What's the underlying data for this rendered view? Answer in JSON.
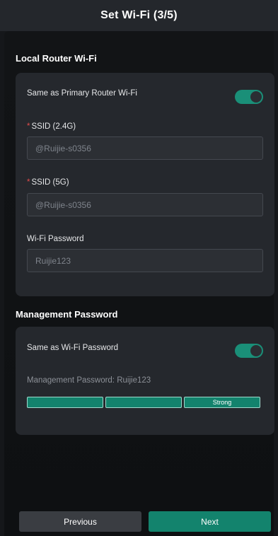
{
  "header": {
    "title": "Set Wi-Fi (3/5)"
  },
  "local_wifi": {
    "section_title": "Local Router Wi-Fi",
    "same_as_primary_label": "Same as Primary Router Wi-Fi",
    "same_as_primary_enabled": true,
    "required_mark": "*",
    "ssid_24_label": "SSID (2.4G)",
    "ssid_24_value": "@Ruijie-s0356",
    "ssid_5_label": "SSID (5G)",
    "ssid_5_value": "@Ruijie-s0356",
    "password_label": "Wi-Fi Password",
    "password_value": "Ruijie123"
  },
  "management": {
    "section_title": "Management Password",
    "same_as_wifi_label": "Same as Wi-Fi Password",
    "same_as_wifi_enabled": true,
    "password_text": "Management Password: Ruijie123",
    "strength_label": "Strong",
    "strength_level": "3 of 3"
  },
  "footer": {
    "previous_label": "Previous",
    "next_label": "Next"
  },
  "colors": {
    "accent": "#13836d",
    "required": "#e24c4c",
    "card": "#25282d",
    "background": "#15171a"
  }
}
